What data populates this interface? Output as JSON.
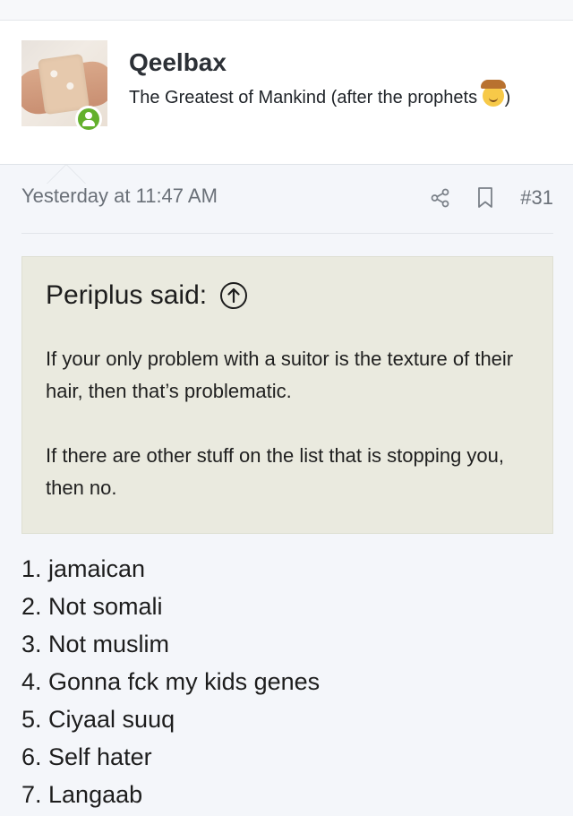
{
  "post": {
    "author": {
      "username": "Qeelbax",
      "title_text": "The Greatest of Mankind (after the prophets",
      "title_emoji": "cowboy-face-emoji",
      "title_close": ")",
      "avatar": "bandaged-arm-avatar",
      "status": "online"
    },
    "timestamp": "Yesterday at 11:47 AM",
    "number": "#31",
    "actions": {
      "share_icon": "share-icon",
      "bookmark_icon": "bookmark-icon"
    },
    "quote": {
      "author_said": "Periplus said:",
      "jump_icon": "circle-arrow-up-icon",
      "paragraphs": [
        "If your only problem with a suitor is the texture of their hair, then that’s problematic.",
        "If there are other stuff on the list that is stopping you, then no."
      ]
    },
    "list": [
      "1. jamaican",
      "2. Not somali",
      "3. Not muslim",
      "4. Gonna fck my kids genes",
      "5. Ciyaal suuq",
      "6. Self hater",
      "7. Langaab"
    ]
  },
  "colors": {
    "page_background": "#f4f6fa",
    "quote_background": "#eaeadf",
    "online_green": "#63b02c",
    "muted_text": "#6a7078"
  }
}
